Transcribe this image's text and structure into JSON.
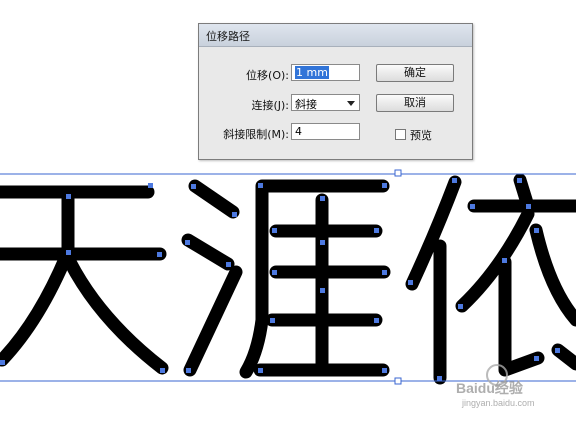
{
  "dialog": {
    "title": "位移路径",
    "offset_label": "位移(O):",
    "offset_value": "1 mm",
    "joins_label": "连接(J):",
    "joins_value": "斜接",
    "miter_label": "斜接限制(M):",
    "miter_value": "4",
    "ok_label": "确定",
    "cancel_label": "取消",
    "preview_label": "预览",
    "preview_checked": false
  },
  "artwork": {
    "characters": [
      "天",
      "涯",
      "依"
    ],
    "stroke_color": "#000000",
    "selection_color": "#3a66d1",
    "anchor_color": "#4d79e0"
  },
  "watermark": {
    "brand": "Baidu经验",
    "url": "jingyan.baidu.com"
  }
}
